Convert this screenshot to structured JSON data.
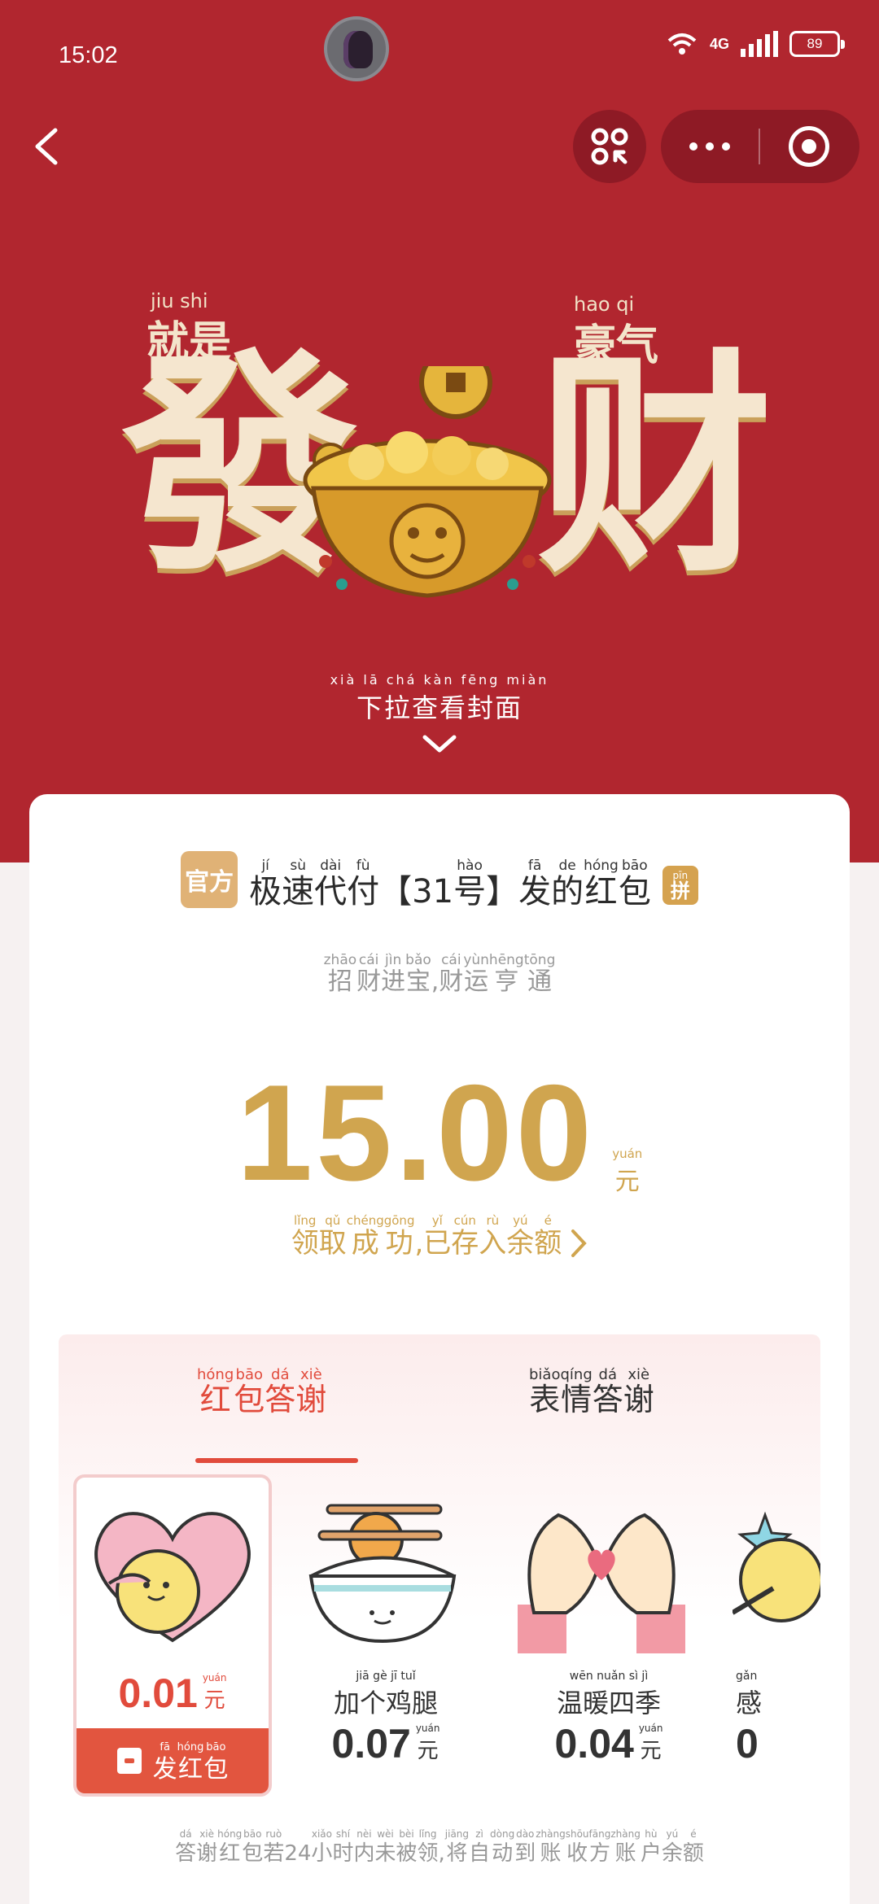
{
  "status_bar": {
    "time": "15:02",
    "network": "4G",
    "battery": "89"
  },
  "cover": {
    "top_left_pinyin": "jiu shi",
    "top_left_text": "就是",
    "top_right_pinyin": "hao qi",
    "top_right_text": "豪气",
    "big_left": "發",
    "big_right": "财"
  },
  "pull_hint": {
    "pinyin": "xià lā chá kàn fēng miàn",
    "text": "下拉查看封面"
  },
  "packet": {
    "official_badge": "官方",
    "title": [
      {
        "c": "极",
        "p": "jí"
      },
      {
        "c": "速",
        "p": "sù"
      },
      {
        "c": "代",
        "p": "dài"
      },
      {
        "c": "付",
        "p": "fù"
      },
      {
        "c": "【31",
        "p": ""
      },
      {
        "c": "号",
        "p": "hào"
      },
      {
        "c": "】",
        "p": ""
      },
      {
        "c": "发",
        "p": "fā"
      },
      {
        "c": "的",
        "p": "de"
      },
      {
        "c": "红",
        "p": "hóng"
      },
      {
        "c": "包",
        "p": "bāo"
      }
    ],
    "pin_badge_pinyin": "pīn",
    "pin_badge": "拼",
    "subtitle": [
      {
        "c": "招",
        "p": "zhāo"
      },
      {
        "c": "财",
        "p": "cái"
      },
      {
        "c": "进",
        "p": "jìn"
      },
      {
        "c": "宝",
        "p": "bǎo"
      },
      {
        "c": ",",
        "p": ""
      },
      {
        "c": "财",
        "p": "cái"
      },
      {
        "c": "运",
        "p": "yùn"
      },
      {
        "c": "亨",
        "p": "hēng"
      },
      {
        "c": "通",
        "p": "tōng"
      }
    ],
    "amount": "15.00",
    "unit_pinyin": "yuán",
    "unit": "元",
    "saved": [
      {
        "c": "领",
        "p": "lǐng"
      },
      {
        "c": "取",
        "p": "qǔ"
      },
      {
        "c": "成",
        "p": "chéng"
      },
      {
        "c": "功",
        "p": "gōng"
      },
      {
        "c": ",",
        "p": ""
      },
      {
        "c": "已",
        "p": "yǐ"
      },
      {
        "c": "存",
        "p": "cún"
      },
      {
        "c": "入",
        "p": "rù"
      },
      {
        "c": "余",
        "p": "yú"
      },
      {
        "c": "额",
        "p": "é"
      }
    ]
  },
  "tabs": [
    {
      "label": "红包答谢",
      "pinyin": "hóng bāo dá xiè"
    },
    {
      "label": "表情答谢",
      "pinyin": "biǎo qíng dá xiè"
    }
  ],
  "gifts": [
    {
      "icon": "heart-hug-icon",
      "amount": "0.01",
      "unit": "元",
      "unit_pinyin": "yuán"
    },
    {
      "icon": "rice-bowl-drumstick-icon",
      "name": "加个鸡腿",
      "name_pinyin": "jiā gè jī tuǐ",
      "amount": "0.07",
      "unit": "元",
      "unit_pinyin": "yuán"
    },
    {
      "icon": "hand-heart-icon",
      "name": "温暖四季",
      "name_pinyin": "wēn nuǎn sì jì",
      "amount": "0.04",
      "unit": "元",
      "unit_pinyin": "yuán"
    },
    {
      "icon": "star-wand-icon",
      "name": "感",
      "name_pinyin": "gǎn",
      "amount": "0"
    }
  ],
  "send_button": {
    "label": "发红包",
    "pinyin": "fā hóng bāo"
  },
  "footer": [
    {
      "c": "答",
      "p": "dá"
    },
    {
      "c": "谢",
      "p": "xiè"
    },
    {
      "c": "红",
      "p": "hóng"
    },
    {
      "c": "包",
      "p": "bāo"
    },
    {
      "c": "若",
      "p": "ruò"
    },
    {
      "c": "24",
      "p": ""
    },
    {
      "c": "小",
      "p": "xiǎo"
    },
    {
      "c": "时",
      "p": "shí"
    },
    {
      "c": "内",
      "p": "nèi"
    },
    {
      "c": "未",
      "p": "wèi"
    },
    {
      "c": "被",
      "p": "bèi"
    },
    {
      "c": "领",
      "p": "lǐng"
    },
    {
      "c": ",",
      "p": ""
    },
    {
      "c": "将",
      "p": "jiāng"
    },
    {
      "c": "自",
      "p": "zì"
    },
    {
      "c": "动",
      "p": "dòng"
    },
    {
      "c": "到",
      "p": "dào"
    },
    {
      "c": "账",
      "p": "zhàng"
    },
    {
      "c": "收",
      "p": "shōu"
    },
    {
      "c": "方",
      "p": "fāng"
    },
    {
      "c": "账",
      "p": "zhàng"
    },
    {
      "c": "户",
      "p": "hù"
    },
    {
      "c": "余",
      "p": "yú"
    },
    {
      "c": "额",
      "p": "é"
    }
  ],
  "colors": {
    "header_red": "#b1262f",
    "gold": "#d0a54f",
    "accent_red": "#e14b3c"
  }
}
